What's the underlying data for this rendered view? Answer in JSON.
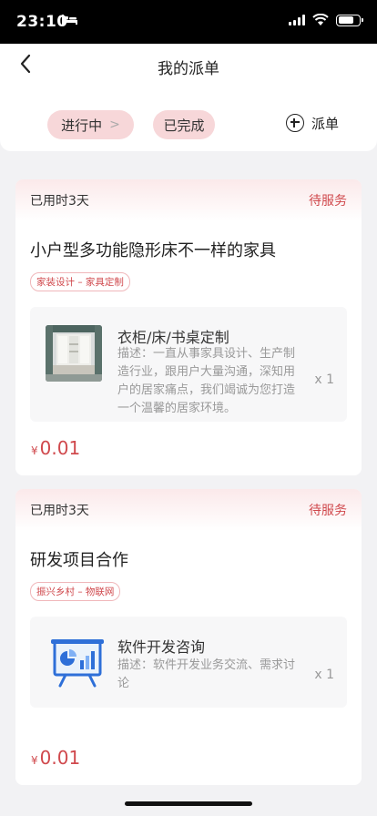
{
  "status_bar": {
    "time": "23:10",
    "bed_icon": "bed-icon",
    "battery_level": 0.75
  },
  "nav": {
    "title": "我的派单",
    "back_icon": "chevron-left-icon"
  },
  "filters": {
    "ongoing_label": "进行中",
    "ongoing_arrow": ">",
    "done_label": "已完成",
    "dispatch_label": "派单",
    "accent": "#d0494d",
    "chip_bg": "#f7d7d9"
  },
  "orders": [
    {
      "elapsed": "已用时3天",
      "status": "待服务",
      "title": "小户型多功能隐形床不一样的家具",
      "tag": "家装设计 – 家具定制",
      "service_name": "衣柜/床/书桌定制",
      "service_desc": "描述：一直从事家具设计、生产制造行业，跟用户大量沟通，深知用户的居家痛点，我们竭诚为您打造一个温馨的居家环境。",
      "qty": "x 1",
      "currency": "¥",
      "price": "0.01",
      "thumb_icon": "furniture-room-image"
    },
    {
      "elapsed": "已用时3天",
      "status": "待服务",
      "title": "研发项目合作",
      "tag": "振兴乡村 – 物联网",
      "service_name": "软件开发咨询",
      "service_desc": "描述：软件开发业务交流、需求讨论",
      "qty": "x 1",
      "currency": "¥",
      "price": "0.01",
      "thumb_icon": "presentation-chart-icon"
    }
  ]
}
